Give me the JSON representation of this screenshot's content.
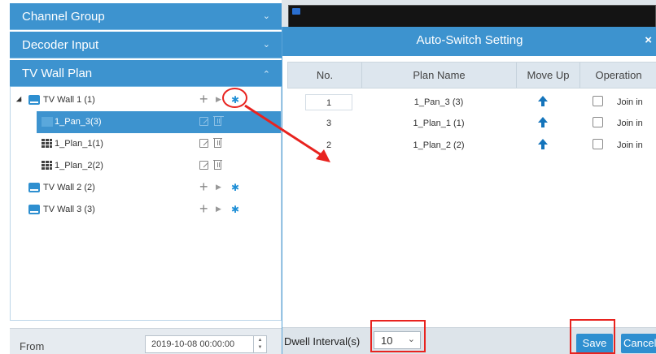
{
  "sidebar": {
    "accordions": {
      "channel_group": "Channel Group",
      "decoder_input": "Decoder Input",
      "tv_wall_plan": "TV Wall Plan"
    },
    "tree": {
      "walls": [
        {
          "label": "TV Wall 1 (1)"
        },
        {
          "label": "TV Wall 2 (2)"
        },
        {
          "label": "TV Wall 3 (3)"
        }
      ],
      "plans": [
        {
          "label": "1_Pan_3(3)"
        },
        {
          "label": "1_Plan_1(1)"
        },
        {
          "label": "1_Plan_2(2)"
        }
      ]
    },
    "from": {
      "label": "From",
      "value": "2019-10-08 00:00:00"
    }
  },
  "dialog": {
    "title": "Auto-Switch Setting",
    "close_glyph": "×",
    "columns": [
      "No.",
      "Plan Name",
      "Move Up",
      "Operation"
    ],
    "rows": [
      {
        "no": "1",
        "name": "1_Pan_3 (3)",
        "join": "Join in"
      },
      {
        "no": "3",
        "name": "1_Plan_1 (1)",
        "join": "Join in"
      },
      {
        "no": "2",
        "name": "1_Plan_2 (2)",
        "join": "Join in"
      }
    ],
    "footer": {
      "dwell_label": "Dwell Interval(s)",
      "dwell_value": "10",
      "save_label": "Save",
      "cancel_label": "Cancel"
    }
  },
  "icons": {
    "gear": "gear-icon",
    "add": "plus-icon",
    "play": "play-icon",
    "edit": "edit-icon",
    "delete": "trash-icon",
    "tv": "tv-wall-icon",
    "plan": "grid-plan-icon",
    "move_up": "arrow-up-icon"
  },
  "colors": {
    "accent": "#3d93cf",
    "annotation_red": "#e8231f",
    "arrow_blue": "#1474bb"
  }
}
